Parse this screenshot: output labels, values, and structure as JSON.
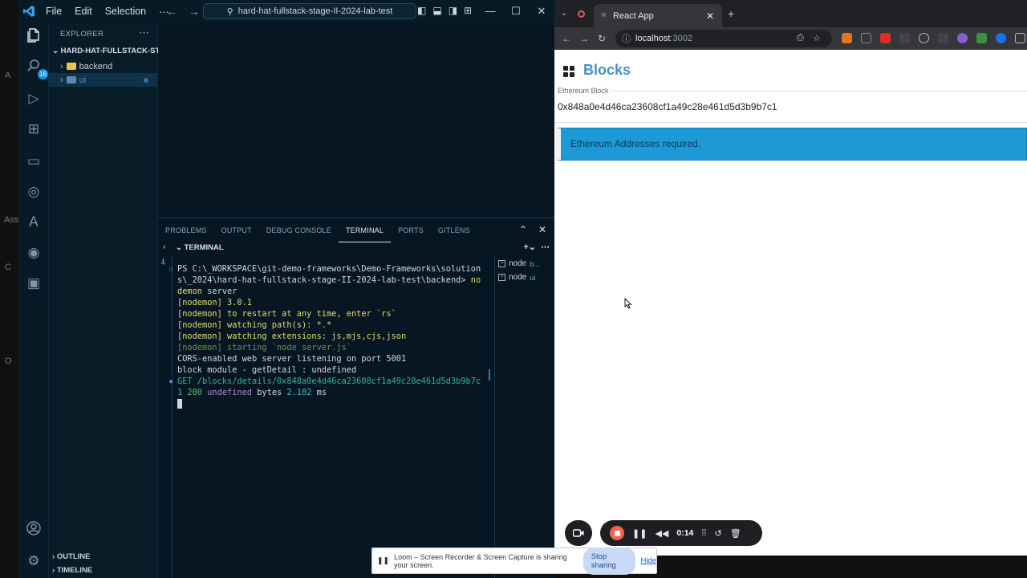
{
  "desktop": {
    "fragments": [
      "A",
      "Ass",
      "C",
      "O"
    ]
  },
  "vscode": {
    "menu": [
      "File",
      "Edit",
      "Selection",
      "⋯"
    ],
    "search_text": "hard-hat-fullstack-stage-II-2024-lab-test",
    "activity_badge": "16",
    "explorer_header": "EXPLORER",
    "root_folder": "HARD-HAT-FULLSTACK-ST...",
    "tree": [
      {
        "label": "backend"
      },
      {
        "label": "ui"
      }
    ],
    "outline_label": "OUTLINE",
    "timeline_label": "TIMELINE",
    "panel_tabs": [
      "PROBLEMS",
      "OUTPUT",
      "DEBUG CONSOLE",
      "TERMINAL",
      "PORTS",
      "GITLENS"
    ],
    "active_tab_index": 3,
    "terminal_header": "TERMINAL",
    "terminal": {
      "prompt_1": "PS C:\\_WORKSPACE\\git-demo-frameworks\\Demo-Frameworks\\solution",
      "prompt_2": "s\\_2024\\hard-hat-fullstack-stage-II-2024-lab-test\\backend> ",
      "cmd_1": "no",
      "cmd_2": "demon",
      "cmd_3": " server",
      "nodemon_version": "[nodemon] 3.0.1",
      "nodemon_restart": "[nodemon] to restart at any time, enter `rs`",
      "nodemon_watch": "[nodemon] watching path(s): *.*",
      "nodemon_ext": "[nodemon] watching extensions: js,mjs,cjs,json",
      "nodemon_start": "[nodemon] starting `node server.js`",
      "cors": "CORS-enabled web server listening on port 5001",
      "block_module": "block module - getDetail : undefined",
      "get_line": "GET /blocks/details/0x848a0e4d46ca23608cf1a49c28e461d5d3b9b7c",
      "resp_1": "1 ",
      "resp_status": "200",
      "resp_undef": " undefined",
      "resp_bytes": " bytes ",
      "resp_ms": "2.102",
      "resp_unit": " ms"
    },
    "terminal_list": [
      {
        "name": "node",
        "sub": "b..."
      },
      {
        "name": "node",
        "sub": "ui"
      }
    ]
  },
  "chrome": {
    "tab_title": "React App",
    "url_host": "localhost",
    "url_port": ":3002"
  },
  "page": {
    "title": "Blocks",
    "field_label": "Ethereum Block",
    "field_value": "0x848a0e4d46ca23608cf1a49c28e461d5d3b9b7c1",
    "alert_text": "Ethereum Addresses required.",
    "alert_color": "#1d9ad6"
  },
  "loom": {
    "time": "0:14",
    "share_text": "Loom – Screen Recorder & Screen Capture is sharing your screen.",
    "stop_label": "Stop sharing",
    "hide_label": "Hide"
  }
}
